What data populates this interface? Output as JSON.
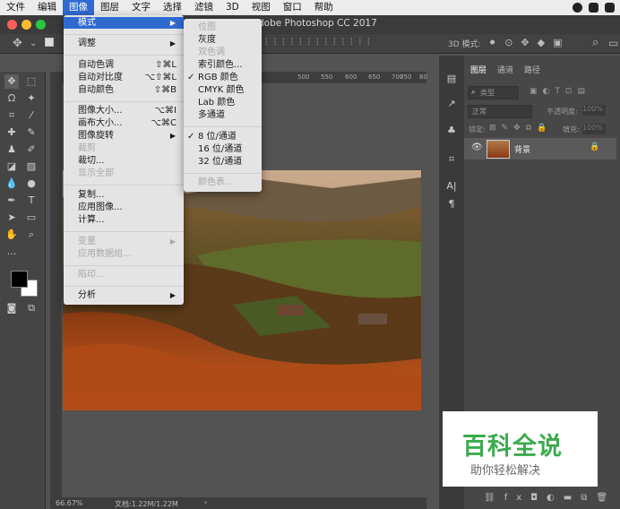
{
  "menubar": {
    "items": [
      "文件",
      "编辑",
      "图像",
      "图层",
      "文字",
      "选择",
      "滤镜",
      "3D",
      "视图",
      "窗口",
      "帮助"
    ]
  },
  "window": {
    "title": "dobe Photoshop CC 2017"
  },
  "optbar": {
    "mode_label": "3D 模式:"
  },
  "ruler": {
    "ticks": [
      "500",
      "550",
      "600",
      "650",
      "700",
      "750",
      "80"
    ]
  },
  "status": {
    "zoom": "66.67%",
    "doc": "文档:1.22M/1.22M"
  },
  "image_menu": {
    "items": [
      {
        "label": "模式",
        "shortcut": "",
        "submenu": true,
        "disabled": false,
        "highlighted": true
      },
      {
        "label": "调整",
        "shortcut": "",
        "submenu": true,
        "disabled": false
      },
      {
        "label": "自动色调",
        "shortcut": "⇧⌘L",
        "disabled": false
      },
      {
        "label": "自动对比度",
        "shortcut": "⌥⇧⌘L",
        "disabled": false
      },
      {
        "label": "自动颜色",
        "shortcut": "⇧⌘B",
        "disabled": false
      },
      {
        "label": "图像大小...",
        "shortcut": "⌥⌘I",
        "disabled": false
      },
      {
        "label": "画布大小...",
        "shortcut": "⌥⌘C",
        "disabled": false
      },
      {
        "label": "图像旋转",
        "shortcut": "",
        "submenu": true,
        "disabled": false
      },
      {
        "label": "裁剪",
        "shortcut": "",
        "disabled": true
      },
      {
        "label": "裁切...",
        "shortcut": "",
        "disabled": false
      },
      {
        "label": "显示全部",
        "shortcut": "",
        "disabled": true
      },
      {
        "label": "复制...",
        "shortcut": "",
        "disabled": false
      },
      {
        "label": "应用图像...",
        "shortcut": "",
        "disabled": false
      },
      {
        "label": "计算...",
        "shortcut": "",
        "disabled": false
      },
      {
        "label": "变量",
        "shortcut": "",
        "submenu": true,
        "disabled": true
      },
      {
        "label": "应用数据组...",
        "shortcut": "",
        "disabled": true
      },
      {
        "label": "陷印...",
        "shortcut": "",
        "disabled": true
      },
      {
        "label": "分析",
        "shortcut": "",
        "submenu": true,
        "disabled": false
      }
    ]
  },
  "mode_menu": {
    "items": [
      {
        "label": "位图",
        "checked": false,
        "disabled": true
      },
      {
        "label": "灰度",
        "checked": false,
        "disabled": false
      },
      {
        "label": "双色调",
        "checked": false,
        "disabled": true
      },
      {
        "label": "索引颜色...",
        "checked": false,
        "disabled": false
      },
      {
        "label": "RGB 颜色",
        "checked": true,
        "disabled": false
      },
      {
        "label": "CMYK 颜色",
        "checked": false,
        "disabled": false
      },
      {
        "label": "Lab 颜色",
        "checked": false,
        "disabled": false
      },
      {
        "label": "多通道",
        "checked": false,
        "disabled": false
      },
      {
        "label": "8 位/通道",
        "checked": true,
        "disabled": false
      },
      {
        "label": "16 位/通道",
        "checked": false,
        "disabled": false
      },
      {
        "label": "32 位/通道",
        "checked": false,
        "disabled": false
      },
      {
        "label": "颜色表...",
        "checked": false,
        "disabled": true
      }
    ]
  },
  "layers_panel": {
    "tabs": [
      "图层",
      "通道",
      "路径"
    ],
    "filter_label": "类型",
    "blend_mode": "正常",
    "opacity_label": "不透明度:",
    "opacity_value": "100%",
    "lock_label": "锁定:",
    "fill_label": "填充:",
    "fill_value": "100%",
    "layer_name": "背景"
  },
  "watermark": {
    "title": "百科全说",
    "subtitle": "助你轻松解决"
  },
  "colors": {
    "menu_highlight": "#2f6ad0",
    "watermark_green": "#3cab4e"
  }
}
